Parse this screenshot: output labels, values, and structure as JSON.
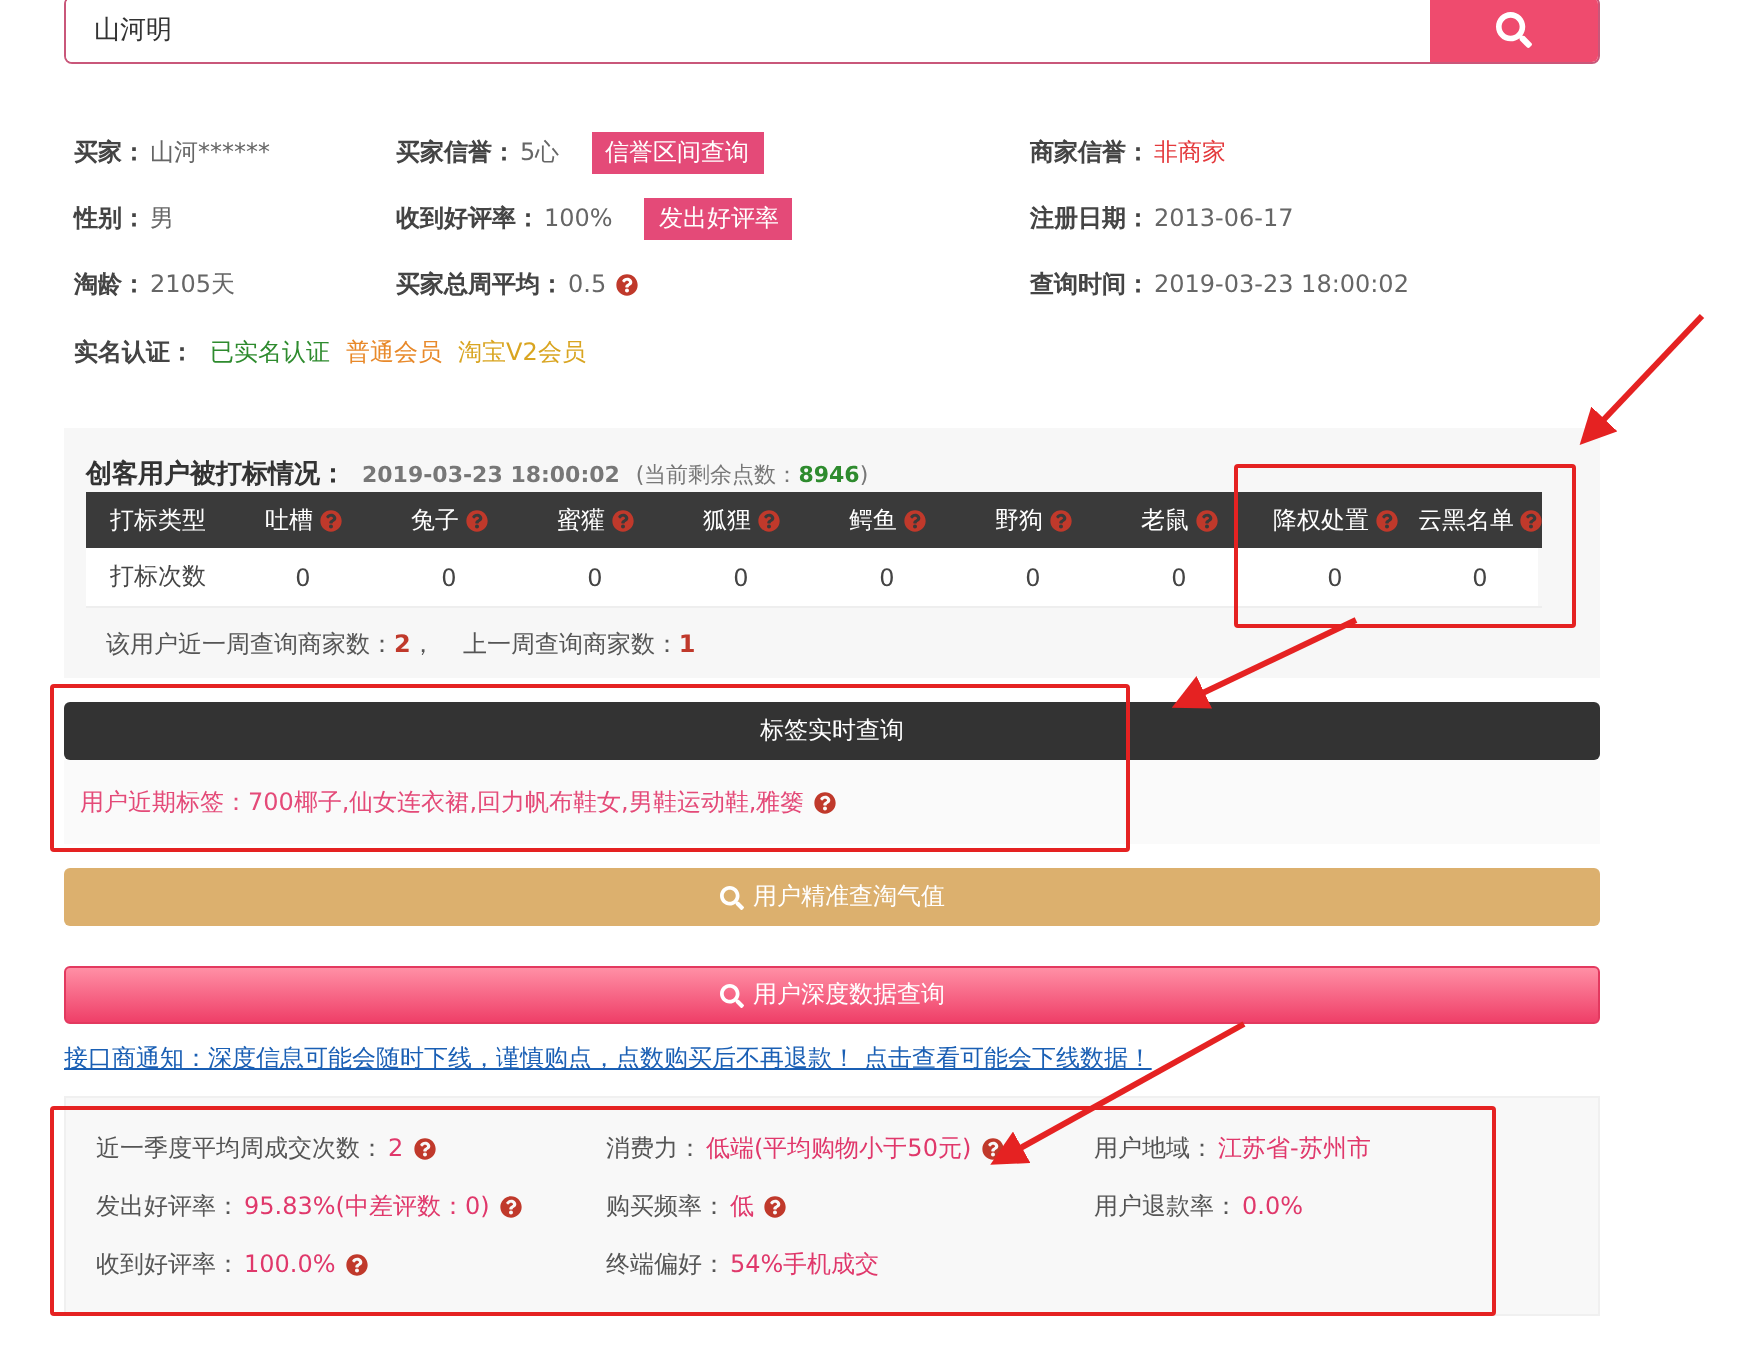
{
  "search": {
    "value": "山河明"
  },
  "info_rows": [
    [
      {
        "label": "买家：",
        "value": "山河******",
        "color": "#666666"
      },
      {
        "label": "买家信誉：",
        "value": "5心",
        "color": "#666666",
        "button": "信誉区间查询"
      },
      {
        "label": "商家信誉：",
        "value": "非商家",
        "color": "#e4393c"
      }
    ],
    [
      {
        "label": "性别：",
        "value": "男",
        "color": "#666666"
      },
      {
        "label": "收到好评率：",
        "value": "100%",
        "color": "#666666",
        "button": "发出好评率"
      },
      {
        "label": "注册日期：",
        "value": "2013-06-17",
        "color": "#666666"
      }
    ],
    [
      {
        "label": "淘龄：",
        "value": "2105天",
        "color": "#666666"
      },
      {
        "label": "买家总周平均：",
        "value": "0.5",
        "color": "#666666",
        "help": true
      },
      {
        "label": "查询时间：",
        "value": "2019-03-23 18:00:02",
        "color": "#666666"
      }
    ]
  ],
  "verification": {
    "label": "实名认证：",
    "badges": [
      {
        "text": "已实名认证",
        "color": "#2e8b2e"
      },
      {
        "text": "普通会员",
        "color": "#e8892a"
      },
      {
        "text": "淘宝V2会员",
        "color": "#d9a521"
      }
    ]
  },
  "marking": {
    "title": "创客用户被打标情况：",
    "time": "2019-03-23 18:00:02",
    "remaining_prefix": "(当前剩余点数：",
    "remaining": "8946",
    "remaining_suffix": ")",
    "columns": [
      {
        "label": "打标类型",
        "help": false
      },
      {
        "label": "吐槽",
        "help": true
      },
      {
        "label": "兔子",
        "help": true
      },
      {
        "label": "蜜獾",
        "help": true
      },
      {
        "label": "狐狸",
        "help": true
      },
      {
        "label": "鳄鱼",
        "help": true
      },
      {
        "label": "野狗",
        "help": true
      },
      {
        "label": "老鼠",
        "help": true
      },
      {
        "label": "降权处置",
        "help": true
      },
      {
        "label": "云黑名单",
        "help": true
      }
    ],
    "row": [
      "打标次数",
      "0",
      "0",
      "0",
      "0",
      "0",
      "0",
      "0",
      "0",
      "0"
    ],
    "footer": [
      {
        "label": "该用户近一周查询商家数：",
        "value": "2",
        "suffix": "，"
      },
      {
        "label": "上一周查询商家数：",
        "value": "1"
      }
    ]
  },
  "tags": {
    "button": "标签实时查询",
    "text": "用户近期标签：700椰子,仙女连衣裙,回力帆布鞋女,男鞋运动鞋,雅篓"
  },
  "actions": [
    {
      "kind": "gold",
      "label": "用户精准查淘气值"
    },
    {
      "kind": "pink",
      "label": "用户深度数据查询"
    }
  ],
  "notice": "接口商通知：深度信息可能会随时下线，谨慎购点，点数购买后不再退款！ 点击查看可能会下线数据！",
  "stats": [
    [
      {
        "label": "近一季度平均周成交次数：",
        "value": "2",
        "help": true
      },
      {
        "label": "消费力：",
        "value": "低端(平均购物小于50元)",
        "help": true
      },
      {
        "label": "用户地域：",
        "value": "江苏省-苏州市",
        "help": false
      }
    ],
    [
      {
        "label": "发出好评率：",
        "value": "95.83%(中差评数：0)",
        "help": true
      },
      {
        "label": "购买频率：",
        "value": "低",
        "help": true
      },
      {
        "label": "用户退款率：",
        "value": "0.0%",
        "help": false
      }
    ],
    [
      {
        "label": "收到好评率：",
        "value": "100.0%",
        "help": true
      },
      {
        "label": "终端偏好：",
        "value": "54%手机成交",
        "help": false
      }
    ]
  ]
}
